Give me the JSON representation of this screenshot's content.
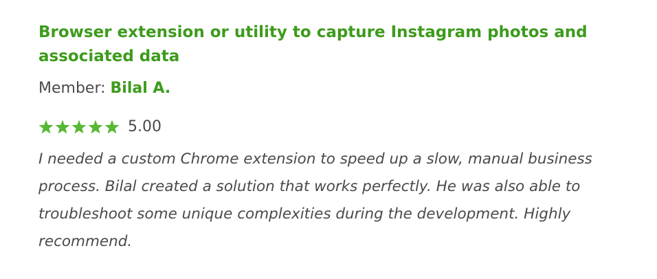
{
  "review": {
    "title": "Browser extension or utility to capture Instagram photos and associated data",
    "member_label": "Member: ",
    "member_name": "Bilal A.",
    "rating": {
      "value": 5,
      "max": 5,
      "display": "5.00"
    },
    "body": "I needed a custom Chrome extension to speed up a slow, manual business process. Bilal created a solution that works perfectly. He was also able to troubleshoot some unique complexities during the development. Highly recommend."
  },
  "colors": {
    "accent": "#3d9b1c",
    "star": "#56b834",
    "text": "#4a4a4a"
  }
}
